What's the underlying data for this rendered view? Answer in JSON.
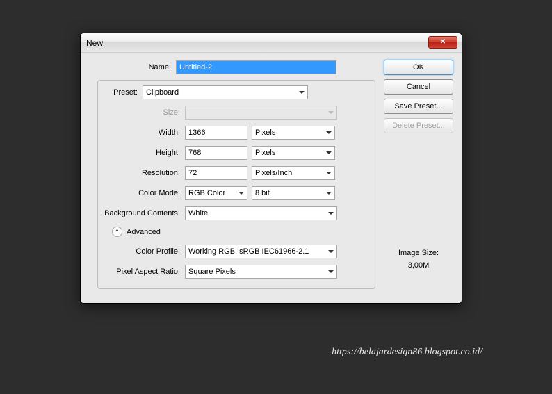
{
  "title": "New",
  "labels": {
    "name": "Name:",
    "preset": "Preset:",
    "size": "Size:",
    "width": "Width:",
    "height": "Height:",
    "resolution": "Resolution:",
    "colorMode": "Color Mode:",
    "bgContents": "Background Contents:",
    "advanced": "Advanced",
    "colorProfile": "Color Profile:",
    "pixelAspect": "Pixel Aspect Ratio:",
    "imageSize": "Image Size:"
  },
  "values": {
    "name": "Untitled-2",
    "preset": "Clipboard",
    "width": "1366",
    "widthUnit": "Pixels",
    "height": "768",
    "heightUnit": "Pixels",
    "resolution": "72",
    "resolutionUnit": "Pixels/Inch",
    "colorMode": "RGB Color",
    "bitDepth": "8 bit",
    "bgContents": "White",
    "colorProfile": "Working RGB: sRGB IEC61966-2.1",
    "pixelAspect": "Square Pixels",
    "imageSizeVal": "3,00M"
  },
  "buttons": {
    "ok": "OK",
    "cancel": "Cancel",
    "savePreset": "Save Preset...",
    "deletePreset": "Delete Preset..."
  },
  "watermark": "https://belajardesign86.blogspot.co.id/"
}
